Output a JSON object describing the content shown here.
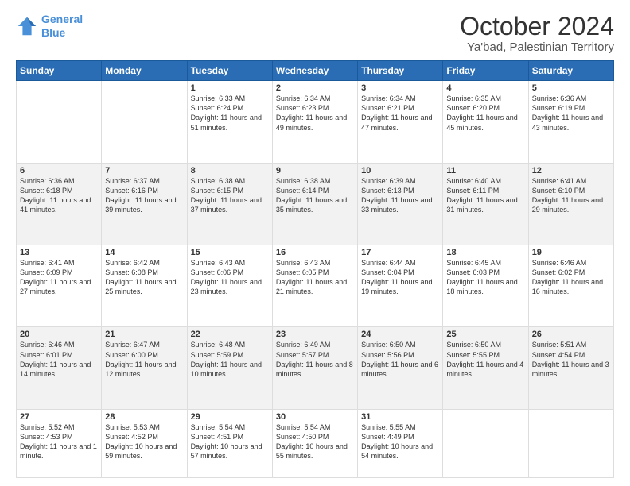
{
  "logo": {
    "line1": "General",
    "line2": "Blue"
  },
  "header": {
    "month": "October 2024",
    "location": "Ya'bad, Palestinian Territory"
  },
  "weekdays": [
    "Sunday",
    "Monday",
    "Tuesday",
    "Wednesday",
    "Thursday",
    "Friday",
    "Saturday"
  ],
  "weeks": [
    [
      {
        "day": "",
        "sunrise": "",
        "sunset": "",
        "daylight": ""
      },
      {
        "day": "",
        "sunrise": "",
        "sunset": "",
        "daylight": ""
      },
      {
        "day": "1",
        "sunrise": "Sunrise: 6:33 AM",
        "sunset": "Sunset: 6:24 PM",
        "daylight": "Daylight: 11 hours and 51 minutes."
      },
      {
        "day": "2",
        "sunrise": "Sunrise: 6:34 AM",
        "sunset": "Sunset: 6:23 PM",
        "daylight": "Daylight: 11 hours and 49 minutes."
      },
      {
        "day": "3",
        "sunrise": "Sunrise: 6:34 AM",
        "sunset": "Sunset: 6:21 PM",
        "daylight": "Daylight: 11 hours and 47 minutes."
      },
      {
        "day": "4",
        "sunrise": "Sunrise: 6:35 AM",
        "sunset": "Sunset: 6:20 PM",
        "daylight": "Daylight: 11 hours and 45 minutes."
      },
      {
        "day": "5",
        "sunrise": "Sunrise: 6:36 AM",
        "sunset": "Sunset: 6:19 PM",
        "daylight": "Daylight: 11 hours and 43 minutes."
      }
    ],
    [
      {
        "day": "6",
        "sunrise": "Sunrise: 6:36 AM",
        "sunset": "Sunset: 6:18 PM",
        "daylight": "Daylight: 11 hours and 41 minutes."
      },
      {
        "day": "7",
        "sunrise": "Sunrise: 6:37 AM",
        "sunset": "Sunset: 6:16 PM",
        "daylight": "Daylight: 11 hours and 39 minutes."
      },
      {
        "day": "8",
        "sunrise": "Sunrise: 6:38 AM",
        "sunset": "Sunset: 6:15 PM",
        "daylight": "Daylight: 11 hours and 37 minutes."
      },
      {
        "day": "9",
        "sunrise": "Sunrise: 6:38 AM",
        "sunset": "Sunset: 6:14 PM",
        "daylight": "Daylight: 11 hours and 35 minutes."
      },
      {
        "day": "10",
        "sunrise": "Sunrise: 6:39 AM",
        "sunset": "Sunset: 6:13 PM",
        "daylight": "Daylight: 11 hours and 33 minutes."
      },
      {
        "day": "11",
        "sunrise": "Sunrise: 6:40 AM",
        "sunset": "Sunset: 6:11 PM",
        "daylight": "Daylight: 11 hours and 31 minutes."
      },
      {
        "day": "12",
        "sunrise": "Sunrise: 6:41 AM",
        "sunset": "Sunset: 6:10 PM",
        "daylight": "Daylight: 11 hours and 29 minutes."
      }
    ],
    [
      {
        "day": "13",
        "sunrise": "Sunrise: 6:41 AM",
        "sunset": "Sunset: 6:09 PM",
        "daylight": "Daylight: 11 hours and 27 minutes."
      },
      {
        "day": "14",
        "sunrise": "Sunrise: 6:42 AM",
        "sunset": "Sunset: 6:08 PM",
        "daylight": "Daylight: 11 hours and 25 minutes."
      },
      {
        "day": "15",
        "sunrise": "Sunrise: 6:43 AM",
        "sunset": "Sunset: 6:06 PM",
        "daylight": "Daylight: 11 hours and 23 minutes."
      },
      {
        "day": "16",
        "sunrise": "Sunrise: 6:43 AM",
        "sunset": "Sunset: 6:05 PM",
        "daylight": "Daylight: 11 hours and 21 minutes."
      },
      {
        "day": "17",
        "sunrise": "Sunrise: 6:44 AM",
        "sunset": "Sunset: 6:04 PM",
        "daylight": "Daylight: 11 hours and 19 minutes."
      },
      {
        "day": "18",
        "sunrise": "Sunrise: 6:45 AM",
        "sunset": "Sunset: 6:03 PM",
        "daylight": "Daylight: 11 hours and 18 minutes."
      },
      {
        "day": "19",
        "sunrise": "Sunrise: 6:46 AM",
        "sunset": "Sunset: 6:02 PM",
        "daylight": "Daylight: 11 hours and 16 minutes."
      }
    ],
    [
      {
        "day": "20",
        "sunrise": "Sunrise: 6:46 AM",
        "sunset": "Sunset: 6:01 PM",
        "daylight": "Daylight: 11 hours and 14 minutes."
      },
      {
        "day": "21",
        "sunrise": "Sunrise: 6:47 AM",
        "sunset": "Sunset: 6:00 PM",
        "daylight": "Daylight: 11 hours and 12 minutes."
      },
      {
        "day": "22",
        "sunrise": "Sunrise: 6:48 AM",
        "sunset": "Sunset: 5:59 PM",
        "daylight": "Daylight: 11 hours and 10 minutes."
      },
      {
        "day": "23",
        "sunrise": "Sunrise: 6:49 AM",
        "sunset": "Sunset: 5:57 PM",
        "daylight": "Daylight: 11 hours and 8 minutes."
      },
      {
        "day": "24",
        "sunrise": "Sunrise: 6:50 AM",
        "sunset": "Sunset: 5:56 PM",
        "daylight": "Daylight: 11 hours and 6 minutes."
      },
      {
        "day": "25",
        "sunrise": "Sunrise: 6:50 AM",
        "sunset": "Sunset: 5:55 PM",
        "daylight": "Daylight: 11 hours and 4 minutes."
      },
      {
        "day": "26",
        "sunrise": "Sunrise: 5:51 AM",
        "sunset": "Sunset: 4:54 PM",
        "daylight": "Daylight: 11 hours and 3 minutes."
      }
    ],
    [
      {
        "day": "27",
        "sunrise": "Sunrise: 5:52 AM",
        "sunset": "Sunset: 4:53 PM",
        "daylight": "Daylight: 11 hours and 1 minute."
      },
      {
        "day": "28",
        "sunrise": "Sunrise: 5:53 AM",
        "sunset": "Sunset: 4:52 PM",
        "daylight": "Daylight: 10 hours and 59 minutes."
      },
      {
        "day": "29",
        "sunrise": "Sunrise: 5:54 AM",
        "sunset": "Sunset: 4:51 PM",
        "daylight": "Daylight: 10 hours and 57 minutes."
      },
      {
        "day": "30",
        "sunrise": "Sunrise: 5:54 AM",
        "sunset": "Sunset: 4:50 PM",
        "daylight": "Daylight: 10 hours and 55 minutes."
      },
      {
        "day": "31",
        "sunrise": "Sunrise: 5:55 AM",
        "sunset": "Sunset: 4:49 PM",
        "daylight": "Daylight: 10 hours and 54 minutes."
      },
      {
        "day": "",
        "sunrise": "",
        "sunset": "",
        "daylight": ""
      },
      {
        "day": "",
        "sunrise": "",
        "sunset": "",
        "daylight": ""
      }
    ]
  ]
}
